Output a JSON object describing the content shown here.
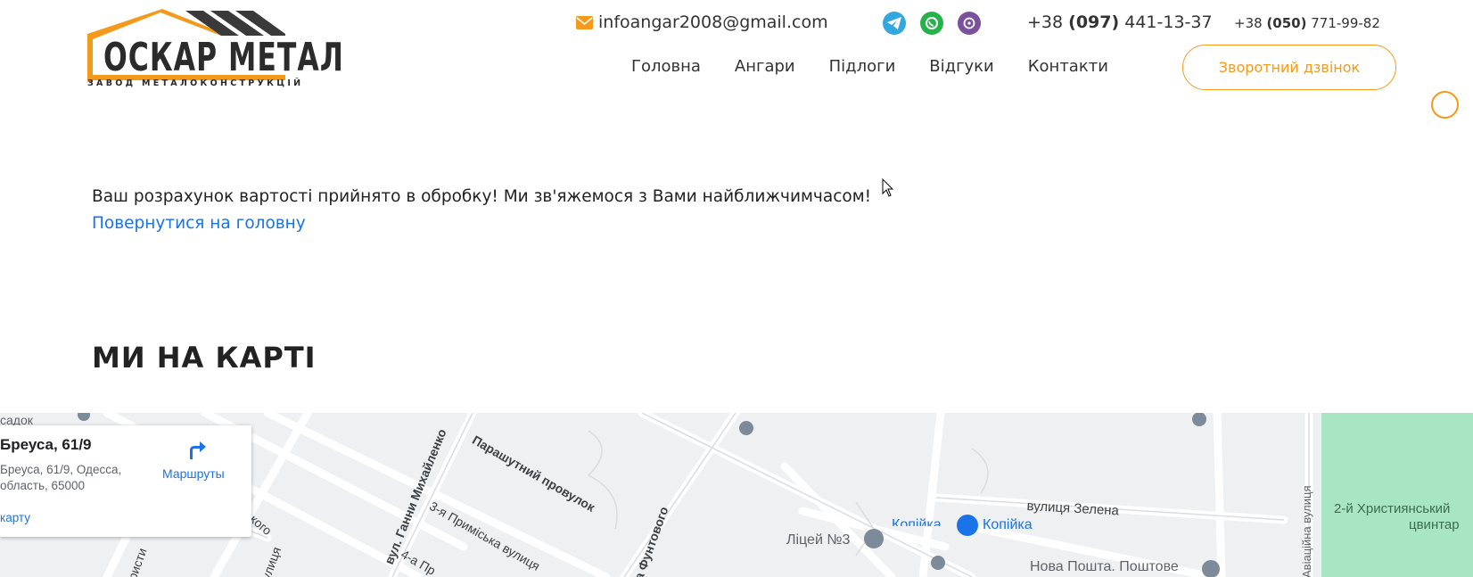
{
  "header": {
    "logo": {
      "brand": "ОСКАР МЕТАЛ",
      "tagline": "ЗАВОД МЕТАЛОКОНСТРУКЦІЙ"
    },
    "email": "infoangar2008@gmail.com",
    "messengers": [
      "telegram-icon",
      "whatsapp-icon",
      "viber-icon"
    ],
    "phone1": {
      "prefix": "+38",
      "code": "(097)",
      "number": "441-13-37"
    },
    "phone2": {
      "prefix": "+38",
      "code": "(050)",
      "number": "771-99-82"
    },
    "nav": [
      "Головна",
      "Ангари",
      "Підлоги",
      "Відгуки",
      "Контакти"
    ],
    "callback_label": "Зворотний дзвінок"
  },
  "message": {
    "text": "Ваш розрахунок вартості прийнято в обробку! Ми зв'яжемося з Вами найближчимчасом!",
    "back_link": "Повернутися на головну"
  },
  "map_section": {
    "title": "МИ НА КАРТІ",
    "card": {
      "title": "Бреуса, 61/9",
      "address_line1": "Бреуса, 61/9, Одесса,",
      "address_line2": "область, 65000",
      "link": "карту",
      "routes_label": "Маршруты"
    },
    "labels": {
      "parashutnyi": "Парашутний провулок",
      "mykhailenko": "вул. Ганни Михайленко",
      "prymiska3": "3-я Приміська вулиця",
      "prymiska4": "4-а Пр",
      "funtovoho": "а Фунтового",
      "zelena": "вулиця Зелена",
      "lyceum": "Ліцей №3",
      "kopiika": "Копійка",
      "kopiika_top": "Копійка",
      "nova_poshta": "Нова Пошта. Поштове",
      "aviatsiina": "Авіаційна вулиця",
      "cemetery_line1": "2-й Християнський",
      "cemetery_line2": "цвинтар",
      "sadok": "садок",
      "left_street1": "ького",
      "left_street2": "улиця",
      "left_street3": "ристи"
    },
    "colors": {
      "park": "#a8e6c1",
      "poi_blue": "#1a73e8",
      "accent": "#f39a1d"
    }
  }
}
